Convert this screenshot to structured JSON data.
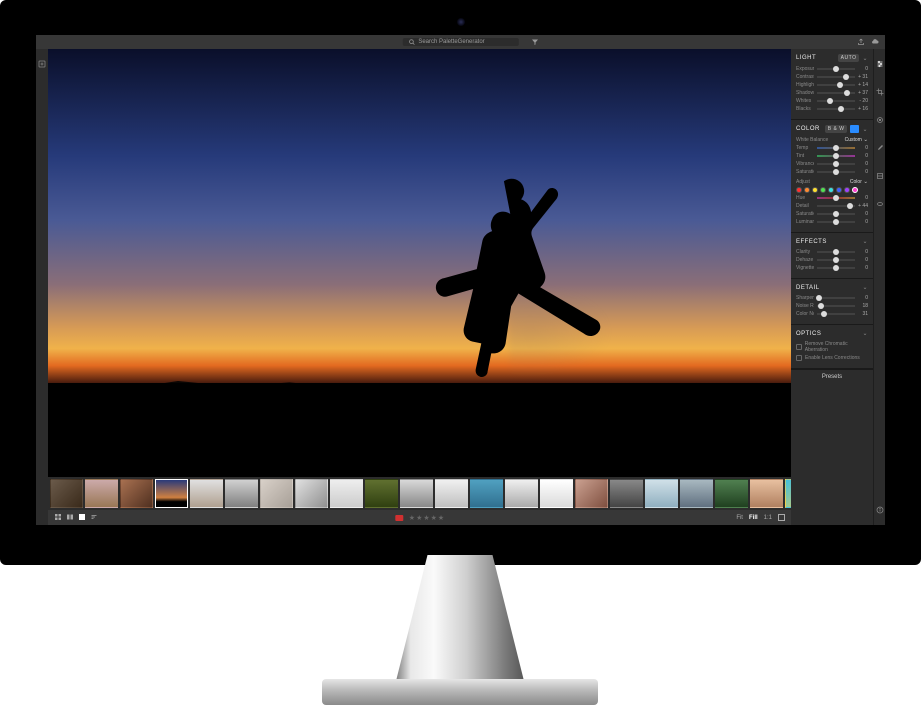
{
  "topbar": {
    "search_placeholder": "Search PaletteGenerator",
    "home_label": "home",
    "cloud_label": "cloud-sync",
    "filter_label": "filter"
  },
  "bottombar": {
    "fit": "Fit",
    "fill": "Fill",
    "oneone": "1:1",
    "stars": 5,
    "flag_color": "#d03030"
  },
  "filmstrip": {
    "selected_index": 3,
    "thumbs": [
      {
        "bg": "linear-gradient(135deg,#6a5a4a,#3a2a1a)"
      },
      {
        "bg": "linear-gradient(180deg,#caa,#975)"
      },
      {
        "bg": "linear-gradient(135deg,#a87050,#503020)"
      },
      {
        "bg": "linear-gradient(180deg,#2a3a7a 0%,#d08040 65%,#000 80%)"
      },
      {
        "bg": "linear-gradient(180deg,#e0e0e0,#b0a090)"
      },
      {
        "bg": "linear-gradient(180deg,#d0d0d0,#808080)"
      },
      {
        "bg": "linear-gradient(135deg,#d8d0c8,#a8a098)"
      },
      {
        "bg": "linear-gradient(135deg,#e0e0e0,#909090)"
      },
      {
        "bg": "linear-gradient(180deg,#eeeeee,#cccccc)"
      },
      {
        "bg": "linear-gradient(180deg,#607030,#304010)"
      },
      {
        "bg": "linear-gradient(180deg,#d8d8d8,#888)"
      },
      {
        "bg": "linear-gradient(180deg,#f0f0f0,#c0c0c0)"
      },
      {
        "bg": "linear-gradient(180deg,#50a0c0,#307090)"
      },
      {
        "bg": "linear-gradient(180deg,#efefef,#aaa)"
      },
      {
        "bg": "linear-gradient(180deg,#fff,#dadada)"
      },
      {
        "bg": "linear-gradient(135deg,#caa090,#805040)"
      },
      {
        "bg": "linear-gradient(180deg,#888,#444)"
      },
      {
        "bg": "linear-gradient(180deg,#d0e0e8,#90b0c0)"
      },
      {
        "bg": "linear-gradient(180deg,#a8b8c0,#607080)"
      },
      {
        "bg": "linear-gradient(180deg,#508050,#204020)"
      },
      {
        "bg": "linear-gradient(180deg,#e8c0a0,#b08060)"
      },
      {
        "bg": "linear-gradient(135deg,#40c0e0,#ffd040)"
      },
      {
        "bg": "linear-gradient(180deg,#eaeaea,#bbb)"
      }
    ]
  },
  "panels": {
    "light": {
      "title": "LIGHT",
      "auto": "AUTO",
      "sliders": [
        {
          "label": "Exposure",
          "value": 0,
          "pos": 50,
          "display": "0"
        },
        {
          "label": "Contrast",
          "value": 31,
          "pos": 75,
          "display": "+ 31"
        },
        {
          "label": "Highlights",
          "value": 14,
          "pos": 60,
          "display": "+ 14"
        },
        {
          "label": "Shadows",
          "value": 37,
          "pos": 78,
          "display": "+ 37"
        },
        {
          "label": "Whites",
          "value": -20,
          "pos": 35,
          "display": "- 20"
        },
        {
          "label": "Blacks",
          "value": 16,
          "pos": 62,
          "display": "+ 16"
        }
      ]
    },
    "color": {
      "title": "COLOR",
      "bw": "B & W",
      "wb_label": "White Balance",
      "wb_value": "Custom",
      "sliders": [
        {
          "label": "Temp",
          "value": 0,
          "pos": 50,
          "display": "0",
          "grad": "grad-temp"
        },
        {
          "label": "Tint",
          "value": 0,
          "pos": 50,
          "display": "0",
          "grad": "grad-tint"
        },
        {
          "label": "Vibrance",
          "value": 0,
          "pos": 50,
          "display": "0"
        },
        {
          "label": "Saturation",
          "value": 0,
          "pos": 50,
          "display": "0"
        }
      ],
      "adjust_label": "Adjust",
      "adjust_value": "Color",
      "swatches": [
        "#ff3030",
        "#ff8a30",
        "#ffe030",
        "#50e050",
        "#40e0e0",
        "#4060ff",
        "#a040ff",
        "#ff40d0"
      ],
      "swatch_selected": 7,
      "hsl": [
        {
          "label": "Hue",
          "value": 0,
          "pos": 50,
          "display": "0",
          "grad": "grad-hue"
        },
        {
          "label": "Detail",
          "value": 44,
          "pos": 88,
          "display": "+ 44"
        },
        {
          "label": "Saturation",
          "value": 0,
          "pos": 50,
          "display": "0"
        },
        {
          "label": "Luminance",
          "value": 0,
          "pos": 50,
          "display": "0"
        }
      ]
    },
    "effects": {
      "title": "EFFECTS",
      "sliders": [
        {
          "label": "Clarity",
          "value": 0,
          "pos": 50,
          "display": "0"
        },
        {
          "label": "Dehaze",
          "value": 0,
          "pos": 50,
          "display": "0"
        },
        {
          "label": "Vignette",
          "value": 0,
          "pos": 50,
          "display": "0"
        }
      ]
    },
    "detail": {
      "title": "DETAIL",
      "sliders": [
        {
          "label": "Sharpening",
          "value": 0,
          "pos": 6,
          "display": "0"
        },
        {
          "label": "Noise Reduction",
          "value": 18,
          "pos": 10,
          "display": "18"
        },
        {
          "label": "Color Noise Reduction",
          "value": 31,
          "pos": 18,
          "display": "31"
        }
      ],
      "extra": [
        {
          "label": "",
          "value": 0,
          "pos": 8,
          "display": ""
        }
      ]
    },
    "optics": {
      "title": "OPTICS",
      "cb1": "Remove Chromatic Aberration",
      "cb2": "Enable Lens Corrections"
    },
    "presets": "Presets"
  }
}
